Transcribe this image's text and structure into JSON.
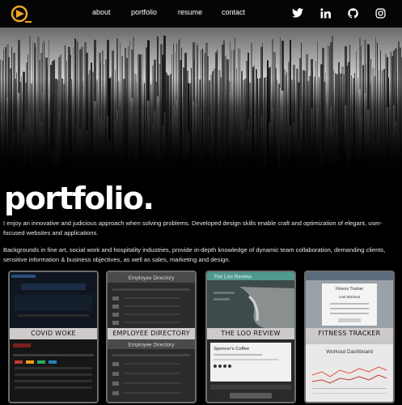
{
  "nav": {
    "links": [
      "about",
      "portfolio",
      "resume",
      "contact"
    ],
    "social": [
      "twitter-icon",
      "linkedin-icon",
      "github-icon",
      "instagram-icon"
    ]
  },
  "colors": {
    "accent": "#f5a623",
    "background": "#000000",
    "card_band": "#cfcaca"
  },
  "page": {
    "title": "portfolio.",
    "intro": "I enjoy an innovative and judicious approach when solving problems. Developed design skills enable craft and optimization of elegant, user-focused websites and applications.",
    "background": "Backgrounds in fine art, social work and hospitality industries, provide in-depth knowledge of dynamic team collaboration, demanding clients, sensitive information & business objectives, as well as sales, marketing and design."
  },
  "projects": [
    {
      "title": "COVID WOKE"
    },
    {
      "title": "EMPLOYEE DIRECTORY",
      "top_header": "Employee Directory",
      "bottom_header": "Employee Directory"
    },
    {
      "title": "THE LOO REVIEW",
      "top_header": "The Loo Review",
      "bottom_caption": "Spencer's Coffee"
    },
    {
      "title": "FITNESS TRACKER",
      "top_header": "Fitness Tracker",
      "top_sub": "Last Workout",
      "bottom_header": "Workout Dashboard"
    }
  ]
}
